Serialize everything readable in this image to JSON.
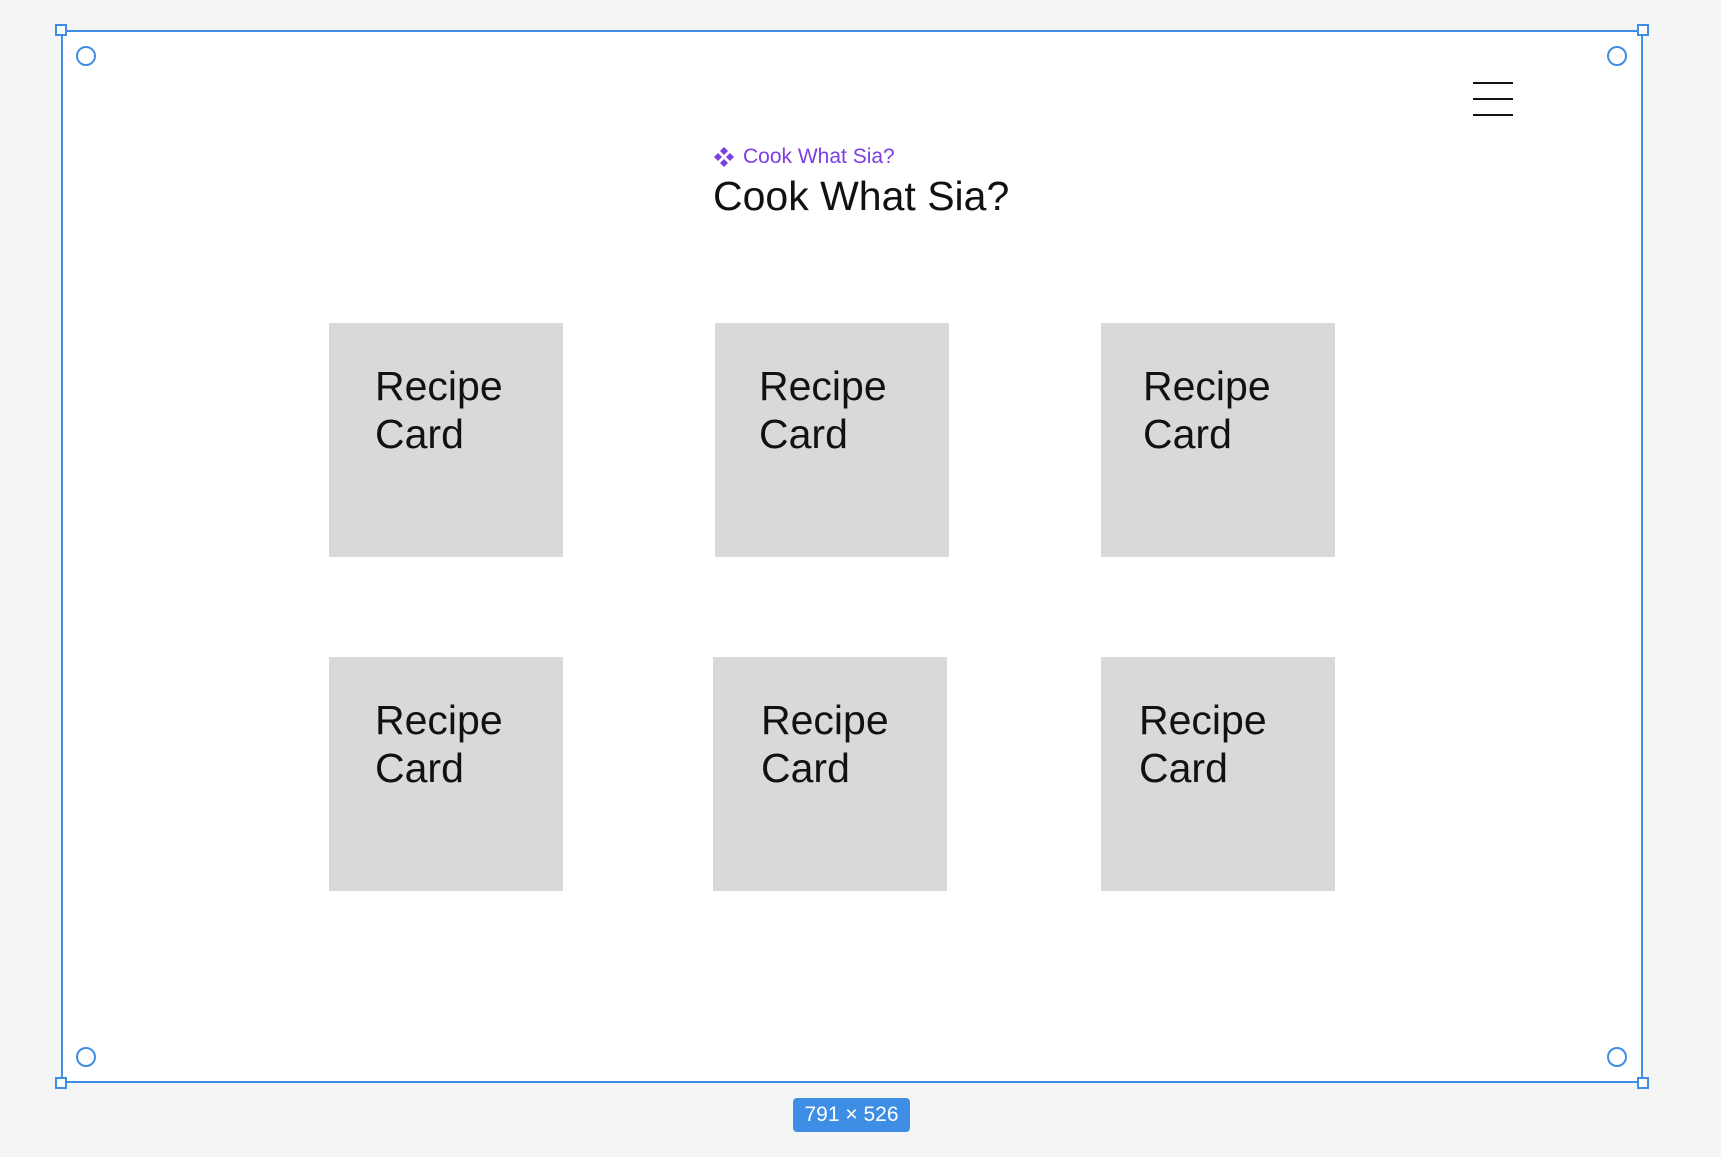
{
  "header": {
    "component_label": "Cook What Sia?",
    "component_icon": "component-diamond-icon",
    "title": "Cook What Sia?",
    "menu_icon": "hamburger-menu-icon"
  },
  "cards": [
    {
      "label": "Recipe Card"
    },
    {
      "label": "Recipe Card"
    },
    {
      "label": "Recipe Card"
    },
    {
      "label": "Recipe Card"
    },
    {
      "label": "Recipe Card"
    },
    {
      "label": "Recipe Card"
    }
  ],
  "selection": {
    "size_label": "791 × 526"
  },
  "colors": {
    "canvas": "#f5f5f5",
    "frame": "#ffffff",
    "selection": "#3e8ee6",
    "component_accent": "#7b3fe4",
    "card_fill": "#d9d9d9"
  }
}
